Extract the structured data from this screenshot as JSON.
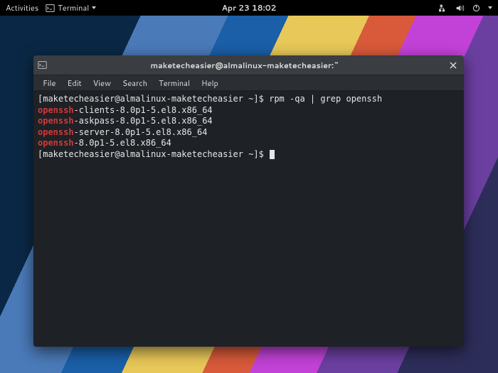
{
  "topbar": {
    "activities": "Activities",
    "app_name": "Terminal",
    "datetime": "Apr 23  18:02"
  },
  "window": {
    "title": "maketecheasier@almalinux-maketecheasier:~"
  },
  "menubar": {
    "items": [
      "File",
      "Edit",
      "View",
      "Search",
      "Terminal",
      "Help"
    ]
  },
  "terminal": {
    "prompt1_pre": "[maketecheasier@almalinux-maketecheasier ~]$ ",
    "command": "rpm -qa | grep openssh",
    "lines": [
      {
        "hl": "openssh",
        "rest": "-clients-8.0p1-5.el8.x86_64"
      },
      {
        "hl": "openssh",
        "rest": "-askpass-8.0p1-5.el8.x86_64"
      },
      {
        "hl": "openssh",
        "rest": "-server-8.0p1-5.el8.x86_64"
      },
      {
        "hl": "openssh",
        "rest": "-8.0p1-5.el8.x86_64"
      }
    ],
    "prompt2_pre": "[maketecheasier@almalinux-maketecheasier ~]$ "
  }
}
